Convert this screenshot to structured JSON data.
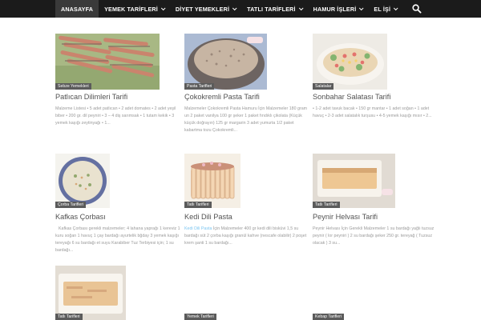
{
  "nav": {
    "items": [
      {
        "label": "ANASAYFA",
        "dropdown": false,
        "active": true
      },
      {
        "label": "YEMEK TARİFLERİ",
        "dropdown": true,
        "active": false
      },
      {
        "label": "DİYET YEMEKLERİ",
        "dropdown": true,
        "active": false
      },
      {
        "label": "TATLI TARİFLERİ",
        "dropdown": true,
        "active": false
      },
      {
        "label": "HAMUR İŞLERİ",
        "dropdown": true,
        "active": false
      },
      {
        "label": "EL İŞİ",
        "dropdown": true,
        "active": false
      }
    ],
    "search_icon": "search-icon"
  },
  "posts": [
    {
      "category": "Sebze Yemekleri",
      "title": "Patlıcan Dilimleri Tarifi",
      "excerpt_link": "",
      "excerpt": "Malzeme Listesi • 5 adet patlıcan • 2 adet domates • 2 adet yeşil biber • 200 gr. dil peyniri • 3 – 4 diş sarımsak • 1 tutam kekik • 3 yemek kaşığı zeytinyağı • 1..."
    },
    {
      "category": "Pasta Tarifleri",
      "title": "Çokokremli Pasta Tarifi",
      "excerpt_link": "",
      "excerpt": "Malzemeler Çokokremli Pasta Hamuru İçin Malzemeler 180 gram un 2 paket vanilya 100 gr şeker 1 paket fındıklı çikolata (Küçük küçük doğrayın) 125 gr margarin 3 adet yumurta 1/2 paket kabartma tozu Çokokremli..."
    },
    {
      "category": "Salatalar",
      "title": "Sonbahar Salatası Tarifi",
      "excerpt_link": "",
      "excerpt": "• 1-2 adet tavuk bacak • 150 gr mantar • 1 adet soğan • 1 adet havuç • 2-3 adet salatalık turşusu • 4-5 yemek kaşığı mısır • 2..."
    },
    {
      "category": "Çorba Tarifleri",
      "title": "Kafkas Çorbası",
      "excerpt_link": "",
      "excerpt": "Kafkas Çorbası gerekli malzemeler; 4 lahana yaprağı 1 kereviz 1 kuru soğan 1 havuç 1 çay bardağı ayurtelik bğday 3 yemek kaşığı tereyağı 6 su bardağı et suyu Karabiber Tuz Terbiyesi için; 1 su bardağı..."
    },
    {
      "category": "Tatlı Tarifleri",
      "title": "Kedi Dili Pasta",
      "excerpt_link": "Kedi Dili Pasta",
      "excerpt": " İçin Malzemeler 400 gr kedi dili bisküvi 1,5 su bardağı süt 2 çorba kaşığı granül kahve (nescafe olabilir) 2 poşet krem şanti 1 su bardağı..."
    },
    {
      "category": "Tatlı Tarifleri",
      "title": "Peynir Helvası Tarifi",
      "excerpt_link": "",
      "excerpt": "Peynir Helvası İçin Gerekli Malzemeler 1 su bardağı yağlı tuzsuz peynir ( lor peyniri ) 2 su bardağı şeker 250 gr. tereyağ ( Tuzsuz olacak ) 3 su..."
    },
    {
      "category": "Tatlı Tarifleri",
      "title": "",
      "excerpt_link": "",
      "excerpt": ""
    },
    {
      "category": "Yemek Tarifleri",
      "title": "",
      "excerpt_link": "",
      "excerpt": ""
    },
    {
      "category": "Kebap Tarifleri",
      "title": "",
      "excerpt_link": "",
      "excerpt": ""
    }
  ],
  "colors": {
    "topbar": "#1b1b1b",
    "active_nav": "#3a3a3a",
    "badge": "#222222",
    "link": "#4db2ec",
    "excerpt": "#777777"
  }
}
